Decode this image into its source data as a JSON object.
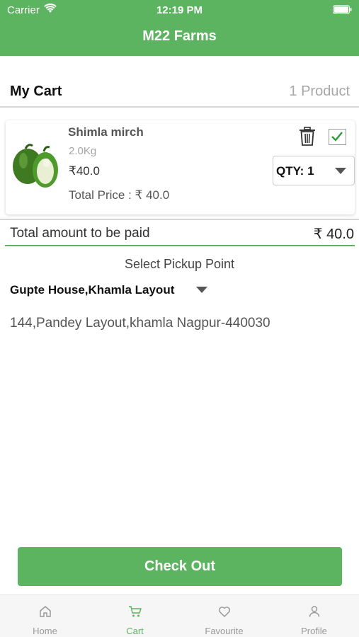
{
  "status_bar": {
    "carrier": "Carrier",
    "time": "12:19 PM"
  },
  "app": {
    "title": "M22 Farms"
  },
  "cart": {
    "title": "My Cart",
    "count": "1 Product"
  },
  "product": {
    "name": "Shimla mirch",
    "weight": "2.0Kg",
    "price": "₹40.0",
    "total_price": "Total Price : ₹ 40.0",
    "quantity": "QTY: 1",
    "selected": true
  },
  "summary": {
    "label": "Total amount to be paid",
    "amount": "₹ 40.0"
  },
  "pickup": {
    "heading": "Select Pickup Point",
    "selected": "Gupte House,Khamla Layout",
    "address": "144,Pandey Layout,khamla Nagpur-440030"
  },
  "checkout": {
    "label": "Check Out"
  },
  "tabs": [
    {
      "label": "Home",
      "icon": "home-icon"
    },
    {
      "label": "Cart",
      "icon": "cart-icon",
      "active": true
    },
    {
      "label": "Favourite",
      "icon": "heart-icon"
    },
    {
      "label": "Profile",
      "icon": "user-icon"
    }
  ],
  "colors": {
    "primary": "#5cb460",
    "muted": "#a7a7a7",
    "tab_inactive": "#999999"
  }
}
